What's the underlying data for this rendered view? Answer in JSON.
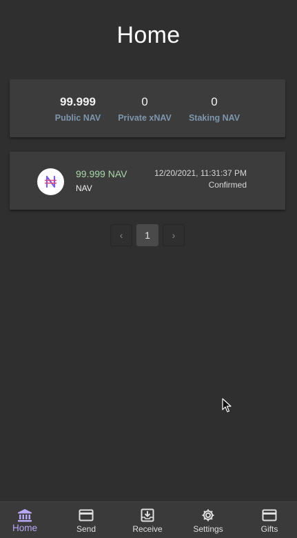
{
  "header": {
    "title": "Home"
  },
  "balances": [
    {
      "value": "99.999",
      "label": "Public NAV"
    },
    {
      "value": "0",
      "label": "Private xNAV"
    },
    {
      "value": "0",
      "label": "Staking NAV"
    }
  ],
  "transactions": [
    {
      "icon": "navcoin-logo-icon",
      "amount": "99.999 NAV",
      "coin": "NAV",
      "date": "12/20/2021, 11:31:37 PM",
      "status": "Confirmed"
    }
  ],
  "pagination": {
    "prev": "‹",
    "current_page": "1",
    "next": "›"
  },
  "bottom_nav": [
    {
      "label": "Home",
      "icon": "bank-icon",
      "active": true
    },
    {
      "label": "Send",
      "icon": "credit-card-icon",
      "active": false
    },
    {
      "label": "Receive",
      "icon": "download-box-icon",
      "active": false
    },
    {
      "label": "Settings",
      "icon": "gear-icon",
      "active": false
    },
    {
      "label": "Gifts",
      "icon": "credit-card-icon",
      "active": false
    }
  ],
  "colors": {
    "background": "#2f2f2f",
    "card": "#3c3c3c",
    "accent": "#b9a8f5",
    "balance_label": "#7e96ad",
    "tx_amount": "#a9d9a9"
  }
}
